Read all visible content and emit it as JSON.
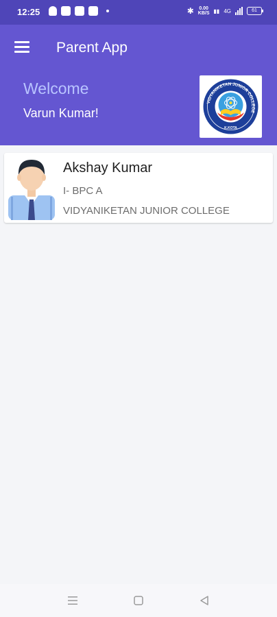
{
  "status_bar": {
    "time": "12:25",
    "network_speed_value": "0.00",
    "network_speed_unit": "KB/S",
    "signal_label": "4G",
    "battery_level": "61"
  },
  "header": {
    "title": "Parent App",
    "welcome": "Welcome",
    "user_name": "Varun Kumar!",
    "logo": {
      "name": "vidyaniketan-junior-college-logo",
      "text_top": "VIDYANIKETAN JUNIOR COLLEGE",
      "text_bottom": "K.KOTA"
    }
  },
  "students": [
    {
      "name": "Akshay Kumar",
      "class": "I- BPC A",
      "college": "VIDYANIKETAN JUNIOR COLLEGE",
      "avatar_icon": "student-avatar-icon"
    }
  ],
  "nav_bar": {
    "buttons": [
      "menu-icon",
      "home-square-icon",
      "back-triangle-icon"
    ]
  },
  "colors": {
    "status_bar": "#4f45b8",
    "header": "#6456d1",
    "welcome_text": "#b9c4ff",
    "background": "#f4f5f8"
  }
}
